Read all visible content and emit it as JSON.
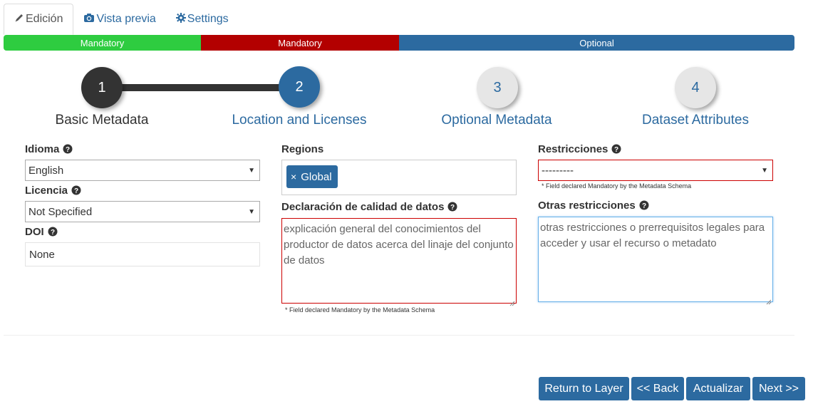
{
  "tabs": [
    {
      "label": "Edición",
      "icon": "pencil-icon",
      "active": true
    },
    {
      "label": "Vista previa",
      "icon": "camera-icon",
      "active": false
    },
    {
      "label": "Settings",
      "icon": "gear-icon",
      "active": false
    }
  ],
  "progress": [
    {
      "label": "Mandatory",
      "color": "#2ecc40",
      "status": "complete"
    },
    {
      "label": "Mandatory",
      "color": "#b30000",
      "status": "error"
    },
    {
      "label": "Optional",
      "color": "#2c6aa0",
      "status": "optional"
    }
  ],
  "steps": [
    {
      "number": "1",
      "label": "Basic Metadata",
      "state": "done"
    },
    {
      "number": "2",
      "label": "Location and Licenses",
      "state": "active"
    },
    {
      "number": "3",
      "label": "Optional Metadata",
      "state": "pending"
    },
    {
      "number": "4",
      "label": "Dataset Attributes",
      "state": "pending"
    }
  ],
  "form": {
    "idioma": {
      "label": "Idioma",
      "value": "English"
    },
    "licencia": {
      "label": "Licencia",
      "value": "Not Specified"
    },
    "doi": {
      "label": "DOI",
      "value": "None"
    },
    "regions": {
      "label": "Regions",
      "tags": [
        "Global"
      ],
      "remove_glyph": "×"
    },
    "calidad": {
      "label": "Declaración de calidad de datos",
      "value": "explicación general del conocimientos del productor de datos acerca del linaje del conjunto de datos",
      "hint": "* Field declared Mandatory by the Metadata Schema"
    },
    "restricciones": {
      "label": "Restricciones",
      "value": "---------",
      "hint": "* Field declared Mandatory by the Metadata Schema"
    },
    "otras": {
      "label": "Otras restricciones",
      "value": "otras restricciones o prerrequisitos legales para acceder y usar el recurso o metadato"
    }
  },
  "buttons": {
    "return": "Return to Layer",
    "back": "<< Back",
    "update": "Actualizar",
    "next": "Next >>"
  }
}
